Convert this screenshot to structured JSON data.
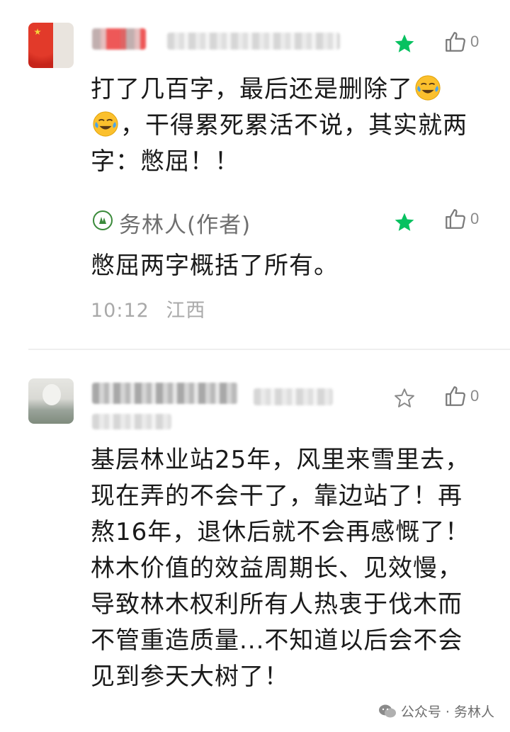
{
  "comments": [
    {
      "text_before_emoji": "打了几百字，最后还是删除了",
      "text_after_emoji": "，干得累死累活不说，其实就两字：憋屈！！",
      "emoji": "face-with-tears-of-joy",
      "starred": true,
      "likes": "0",
      "reply": {
        "author": "务林人(作者)",
        "text": "憋屈两字概括了所有。",
        "starred": true,
        "likes": "0"
      },
      "time": "10:12",
      "location": "江西"
    },
    {
      "text": "基层林业站25年，风里来雪里去，现在弄的不会干了，靠边站了！再熬16年，退休后就不会再感慨了！林木价值的效益周期长、见效慢，导致林木权利所有人热衷于伐木而不管重造质量...不知道以后会不会见到参天大树了！",
      "starred": false,
      "likes": "0"
    }
  ],
  "watermark": "公众号 · 务林人",
  "colors": {
    "star_active": "#07c160",
    "text": "#1a1a1a",
    "muted": "#a9a9a9"
  }
}
